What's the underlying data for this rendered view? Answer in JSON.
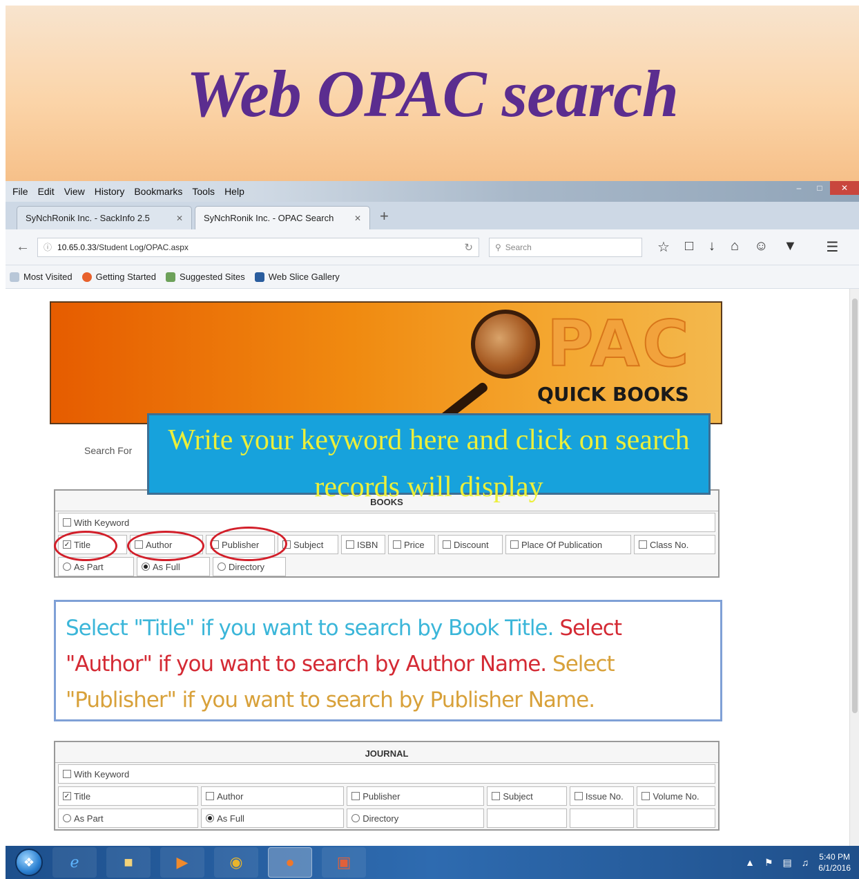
{
  "slide": {
    "title": "Web OPAC search"
  },
  "menubar": {
    "items": [
      "File",
      "Edit",
      "View",
      "History",
      "Bookmarks",
      "Tools",
      "Help"
    ]
  },
  "tabs": [
    {
      "label": "SyNchRonik Inc. - SackInfo 2.5"
    },
    {
      "label": "SyNchRonik Inc. - OPAC Search"
    }
  ],
  "navbar": {
    "url_host": "10.65.0.33",
    "url_path": "/Student Log/OPAC.aspx",
    "search_placeholder": "Search"
  },
  "bookmarks": [
    {
      "label": "Most Visited"
    },
    {
      "label": "Getting Started"
    },
    {
      "label": "Suggested Sites"
    },
    {
      "label": "Web Slice Gallery"
    }
  ],
  "banner": {
    "logo_text": "PAC",
    "subtitle": "QUICK BOOKS"
  },
  "search": {
    "label": "Search For"
  },
  "callout": {
    "text": "Write your keyword here and click on search records will display"
  },
  "books": {
    "legend": "BOOKS",
    "with_keyword": "With Keyword",
    "fields": [
      {
        "label": "Title",
        "checked": true
      },
      {
        "label": "Author",
        "checked": false
      },
      {
        "label": "Publisher",
        "checked": false
      },
      {
        "label": "Subject",
        "checked": false
      },
      {
        "label": "ISBN",
        "checked": false
      },
      {
        "label": "Price",
        "checked": false
      },
      {
        "label": "Discount",
        "checked": false
      },
      {
        "label": "Place Of Publication",
        "checked": false
      },
      {
        "label": "Class No.",
        "checked": false
      }
    ],
    "match": [
      {
        "label": "As Part",
        "selected": false
      },
      {
        "label": "As Full",
        "selected": true
      },
      {
        "label": "Directory",
        "selected": false
      }
    ]
  },
  "info": {
    "part1": "Select \"Title\" if you want to search by Book Title.",
    "part2": "Select \"Author\" if you want to search by Author Name.",
    "part3": "Select \"Publisher\" if you want to search by Publisher Name."
  },
  "journal": {
    "legend": "JOURNAL",
    "with_keyword": "With Keyword",
    "fields": [
      {
        "label": "Title",
        "checked": true
      },
      {
        "label": "Author",
        "checked": false
      },
      {
        "label": "Publisher",
        "checked": false
      },
      {
        "label": "Subject",
        "checked": false
      },
      {
        "label": "Issue No.",
        "checked": false
      },
      {
        "label": "Volume No.",
        "checked": false
      }
    ],
    "match": [
      {
        "label": "As Part",
        "selected": false
      },
      {
        "label": "As Full",
        "selected": true
      },
      {
        "label": "Directory",
        "selected": false
      }
    ]
  },
  "taskbar": {
    "time": "5:40 PM",
    "date": "6/1/2016"
  },
  "colors": {
    "title": "#5b2d8f",
    "callout_bg": "#17a2dc",
    "callout_text": "#ecef3a",
    "highlight_ring": "#d21f2a"
  }
}
